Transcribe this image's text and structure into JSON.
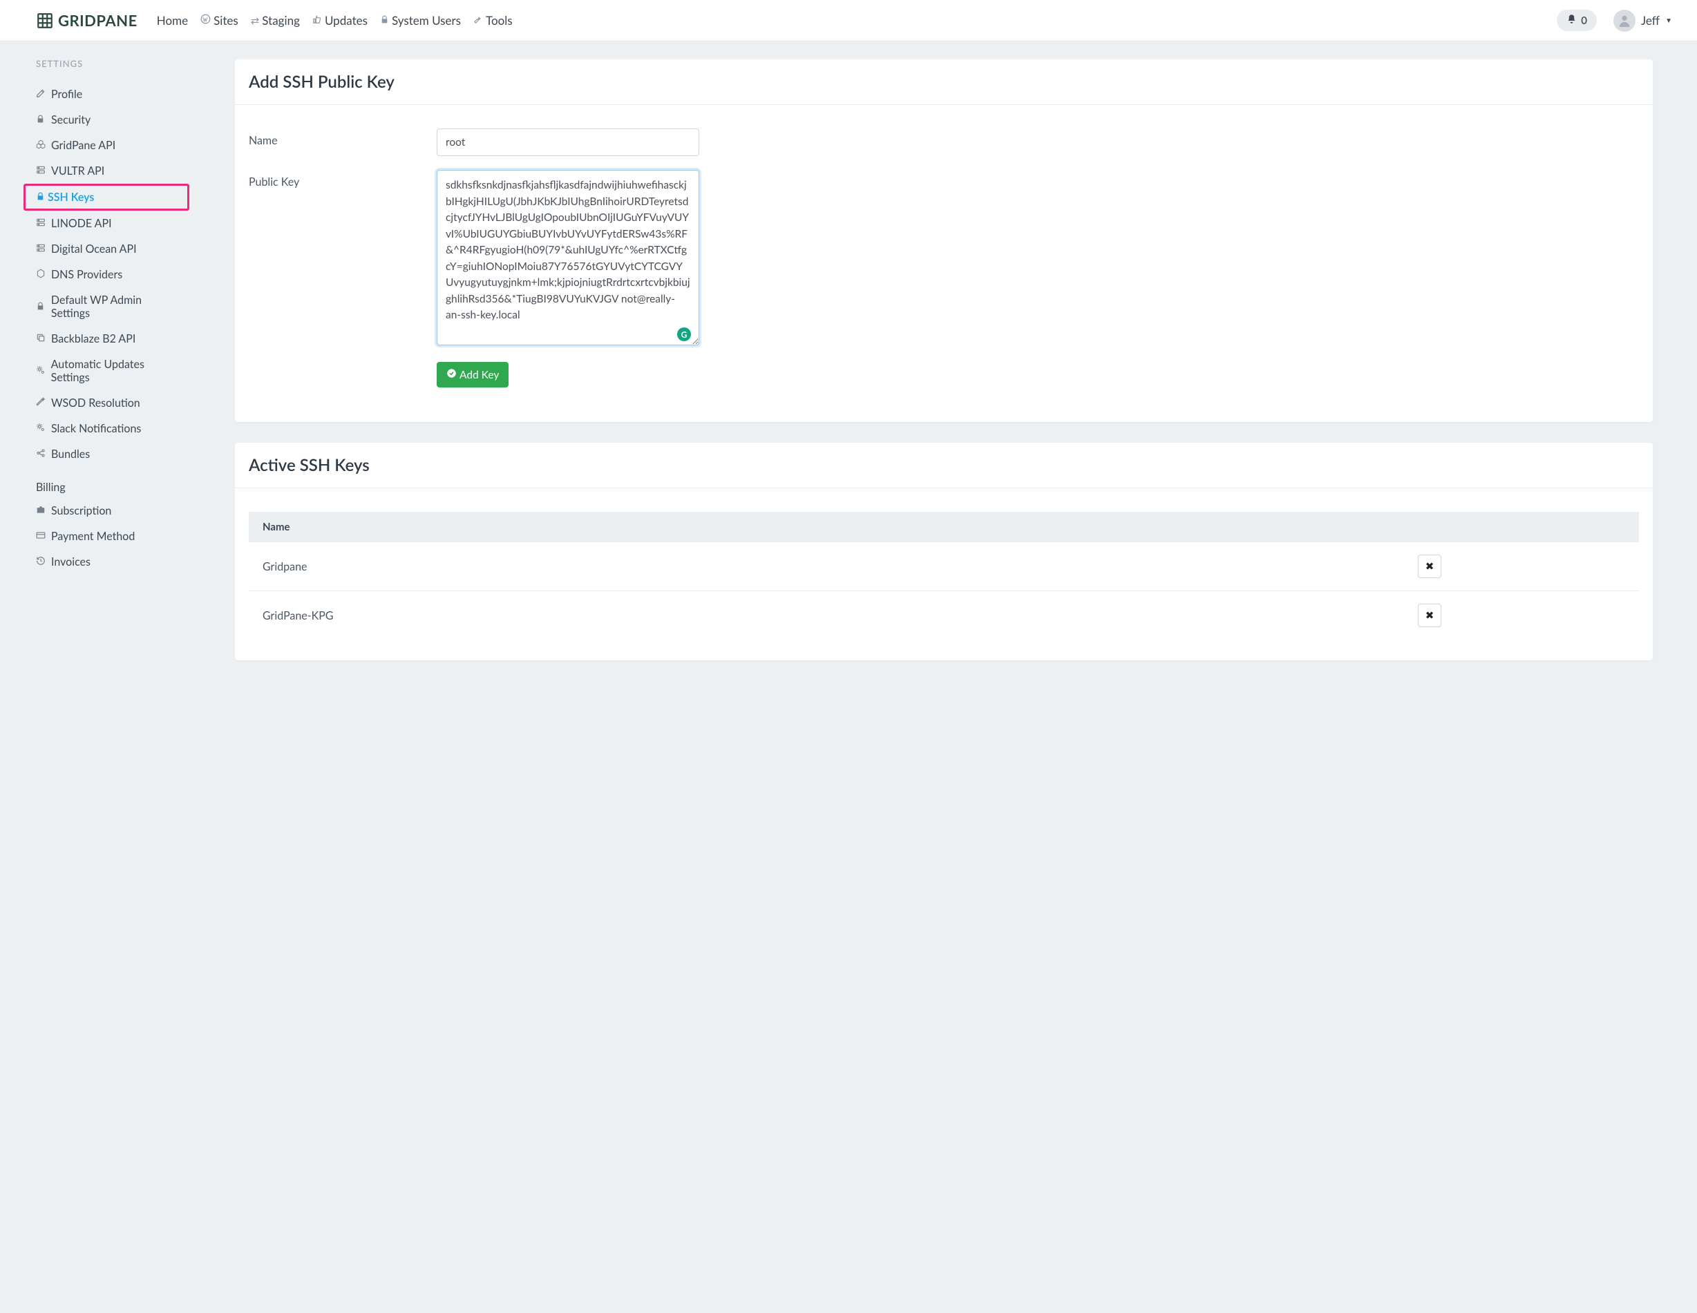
{
  "brand": "GRIDPANE",
  "nav": {
    "home": "Home",
    "sites": "Sites",
    "staging": "Staging",
    "updates": "Updates",
    "system_users": "System Users",
    "tools": "Tools"
  },
  "notifications": {
    "count": "0"
  },
  "user": {
    "name": "Jeff"
  },
  "sidebar": {
    "heading": "SETTINGS",
    "items": {
      "profile": "Profile",
      "security": "Security",
      "gridpane_api": "GridPane API",
      "vultr_api": "VULTR API",
      "ssh_keys": "SSH Keys",
      "linode_api": "LINODE API",
      "digital_ocean_api": "Digital Ocean API",
      "dns_providers": "DNS Providers",
      "default_wp_admin": "Default WP Admin Settings",
      "backblaze": "Backblaze B2 API",
      "auto_updates": "Automatic Updates Settings",
      "wsod": "WSOD Resolution",
      "slack": "Slack Notifications",
      "bundles": "Bundles"
    },
    "billing_heading": "Billing",
    "billing": {
      "subscription": "Subscription",
      "payment_method": "Payment Method",
      "invoices": "Invoices"
    }
  },
  "panels": {
    "add_key": {
      "title": "Add SSH Public Key",
      "name_label": "Name",
      "name_value": "root",
      "public_key_label": "Public Key",
      "public_key_value": "sdkhsfksnkdjnasfkjahsfljkasdfajndwijhiuhwefihasckjbIHgkjHILUgU(JbhJKbKJbIUhgBnIihoirURDTeyretsdcjtycfJYHvLJBlUgUgIOpoubIUbnOIjIUGuYFVuyVUYvI%UbIUGUYGbiuBUYIvbUYvUYFytdERSw43s%RF&^R4RFgyugioH(h09(79*&uhIUgUYfc^%erRTXCtfgcY=giuhIONopIMoiu87Y76576tGYUVytCYTCGVYUvyugyutuygjnkm+lmk;kjpiojniugtRrdrtcxrtcvbjkbiujghlihRsd356&*TiugBI98VUYuKVJGV not@really-an-ssh-key.local",
      "submit": "Add Key"
    },
    "active_keys": {
      "title": "Active SSH Keys",
      "col_name": "Name",
      "rows": [
        {
          "name": "Gridpane"
        },
        {
          "name": "GridPane-KPG"
        }
      ]
    }
  }
}
